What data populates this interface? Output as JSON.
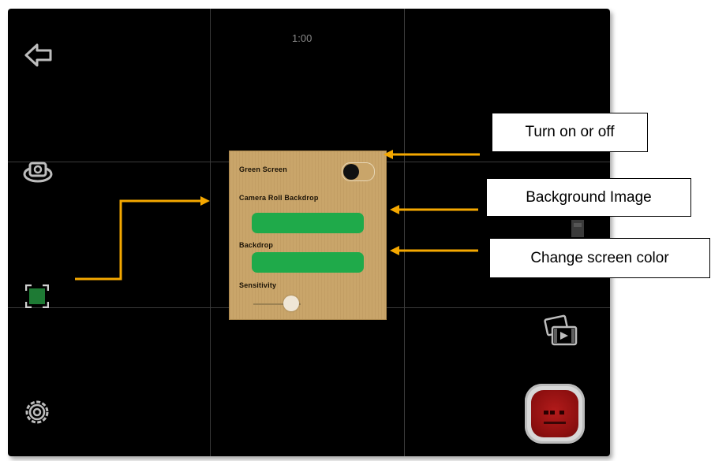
{
  "screen": {
    "timer": "1:00"
  },
  "toolbar_left": {
    "back_icon": "back-arrow-icon",
    "flip_camera_icon": "flip-camera-icon",
    "green_screen_icon": "green-screen-icon",
    "settings_icon": "gear-icon"
  },
  "toolbar_right": {
    "media_icon": "photo-video-icon",
    "record_icon": "record-button-icon"
  },
  "panel": {
    "green_screen_label": "Green Screen",
    "camera_roll_label": "Camera Roll Backdrop",
    "backdrop_label": "Backdrop",
    "sensitivity_label": "Sensitivity",
    "toggle_on": false,
    "sensitivity_value": 0.6
  },
  "annotations": {
    "turn_on_off": "Turn on or off",
    "background_image": "Background Image",
    "change_color": "Change screen color"
  },
  "colors": {
    "panel_bg": "#c9a56a",
    "button_green": "#1faa4a",
    "arrow_orange": "#f5a800",
    "record_red": "#b31b1b"
  }
}
